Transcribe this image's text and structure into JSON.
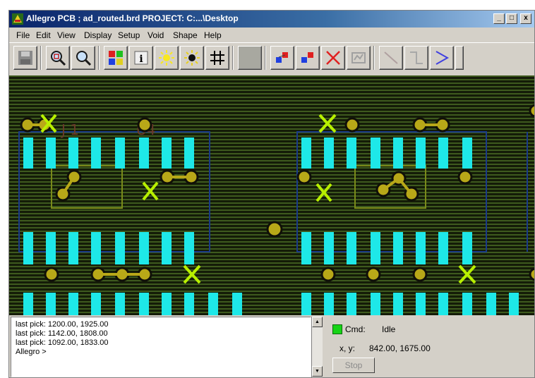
{
  "window": {
    "title": "Allegro PCB ; ad_routed.brd  PROJECT: C:...\\Desktop"
  },
  "titlebar_buttons": {
    "minimize": "_",
    "maximize": "□",
    "close": "x"
  },
  "menu": [
    "File",
    "Edit",
    "View",
    "Display",
    "Setup",
    "Void",
    "Shape",
    "Help"
  ],
  "toolbar": {
    "icons": [
      "save-icon",
      "zoom-fit-icon",
      "zoom-in-icon",
      "color-palette-icon",
      "info-icon",
      "highlight-icon",
      "dehighlight-icon",
      "grid-icon",
      "blank-icon",
      "add-connect-icon",
      "slide-icon",
      "delete-icon",
      "custom-smooth-icon",
      "line-45-icon",
      "route-corner-icon",
      "fanout-icon"
    ]
  },
  "console": {
    "lines": [
      "last pick:  1200.00, 1925.00",
      "last pick:  1142.00, 1808.00",
      "last pick:  1092.00, 1833.00",
      "Allegro >"
    ]
  },
  "status": {
    "cmd_label": "Cmd:",
    "cmd_value": "Idle",
    "xy_label": "x, y:",
    "xy_value": "842.00, 1675.00",
    "stop_label": "Stop",
    "led_color": "#16d416"
  },
  "colors": {
    "pad": "#1ee8e8",
    "via": "#b8a818",
    "ratsnest_x": "#b8f000",
    "outline": "#7a8a1a",
    "board_edge": "#1a3a8a"
  }
}
